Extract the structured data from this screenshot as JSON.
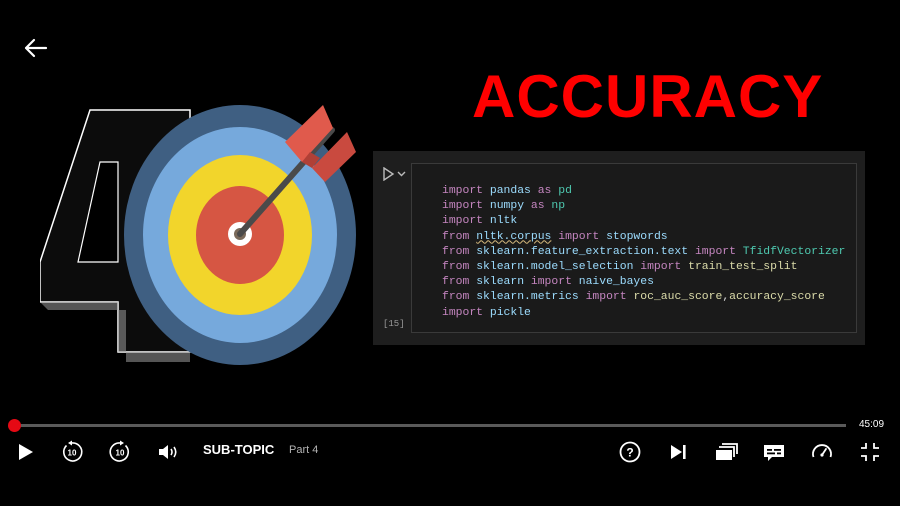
{
  "title": "ACCURACY",
  "colors": {
    "title": "#ff0000",
    "accent": "#e50914",
    "track": "#5a5a5a"
  },
  "code_cell": {
    "execution_count": "[15]",
    "lines": [
      [
        {
          "t": "import",
          "c": "kw"
        },
        {
          "t": " "
        },
        {
          "t": "pandas",
          "c": "mod"
        },
        {
          "t": " "
        },
        {
          "t": "as",
          "c": "kw"
        },
        {
          "t": " "
        },
        {
          "t": "pd",
          "c": "al"
        }
      ],
      [
        {
          "t": "import",
          "c": "kw"
        },
        {
          "t": " "
        },
        {
          "t": "numpy",
          "c": "mod"
        },
        {
          "t": " "
        },
        {
          "t": "as",
          "c": "kw"
        },
        {
          "t": " "
        },
        {
          "t": "np",
          "c": "al"
        }
      ],
      [
        {
          "t": "import",
          "c": "kw"
        },
        {
          "t": " "
        },
        {
          "t": "nltk",
          "c": "mod"
        }
      ],
      [
        {
          "t": "from",
          "c": "kw"
        },
        {
          "t": " "
        },
        {
          "t": "nltk.corpus",
          "c": "mod wavy"
        },
        {
          "t": " "
        },
        {
          "t": "import",
          "c": "kw"
        },
        {
          "t": " "
        },
        {
          "t": "stopwords",
          "c": "mod"
        }
      ],
      [
        {
          "t": "from",
          "c": "kw"
        },
        {
          "t": " "
        },
        {
          "t": "sklearn.feature_extraction.text",
          "c": "mod"
        },
        {
          "t": " "
        },
        {
          "t": "import",
          "c": "kw"
        },
        {
          "t": " "
        },
        {
          "t": "TfidfVectorizer",
          "c": "al"
        }
      ],
      [
        {
          "t": "from",
          "c": "kw"
        },
        {
          "t": " "
        },
        {
          "t": "sklearn.model_selection",
          "c": "mod"
        },
        {
          "t": " "
        },
        {
          "t": "import",
          "c": "kw"
        },
        {
          "t": " "
        },
        {
          "t": "train_test_split",
          "c": "fn"
        }
      ],
      [
        {
          "t": "from",
          "c": "kw"
        },
        {
          "t": " "
        },
        {
          "t": "sklearn",
          "c": "mod"
        },
        {
          "t": " "
        },
        {
          "t": "import",
          "c": "kw"
        },
        {
          "t": " "
        },
        {
          "t": "naive_bayes",
          "c": "mod"
        }
      ],
      [
        {
          "t": "from",
          "c": "kw"
        },
        {
          "t": " "
        },
        {
          "t": "sklearn.metrics",
          "c": "mod"
        },
        {
          "t": " "
        },
        {
          "t": "import",
          "c": "kw"
        },
        {
          "t": " "
        },
        {
          "t": "roc_auc_score",
          "c": "fn"
        },
        {
          "t": ","
        },
        {
          "t": "accuracy_score",
          "c": "fn"
        }
      ],
      [
        {
          "t": "import",
          "c": "kw"
        },
        {
          "t": " "
        },
        {
          "t": "pickle",
          "c": "mod"
        }
      ]
    ]
  },
  "player": {
    "progress": 0.0,
    "time_remaining": "45:09",
    "episode_title": "SUB-TOPIC",
    "episode_sub": "Part 4",
    "skip_back_seconds": "10",
    "skip_forward_seconds": "10"
  },
  "icons": {
    "back": "arrow-left-icon",
    "play": "play-icon",
    "rewind": "rewind-10-icon",
    "forward": "forward-10-icon",
    "volume": "volume-icon",
    "help": "help-icon",
    "next": "next-episode-icon",
    "episodes": "episodes-icon",
    "subtitles": "subtitles-icon",
    "speed": "playback-speed-icon",
    "fullscreen": "exit-fullscreen-icon"
  }
}
